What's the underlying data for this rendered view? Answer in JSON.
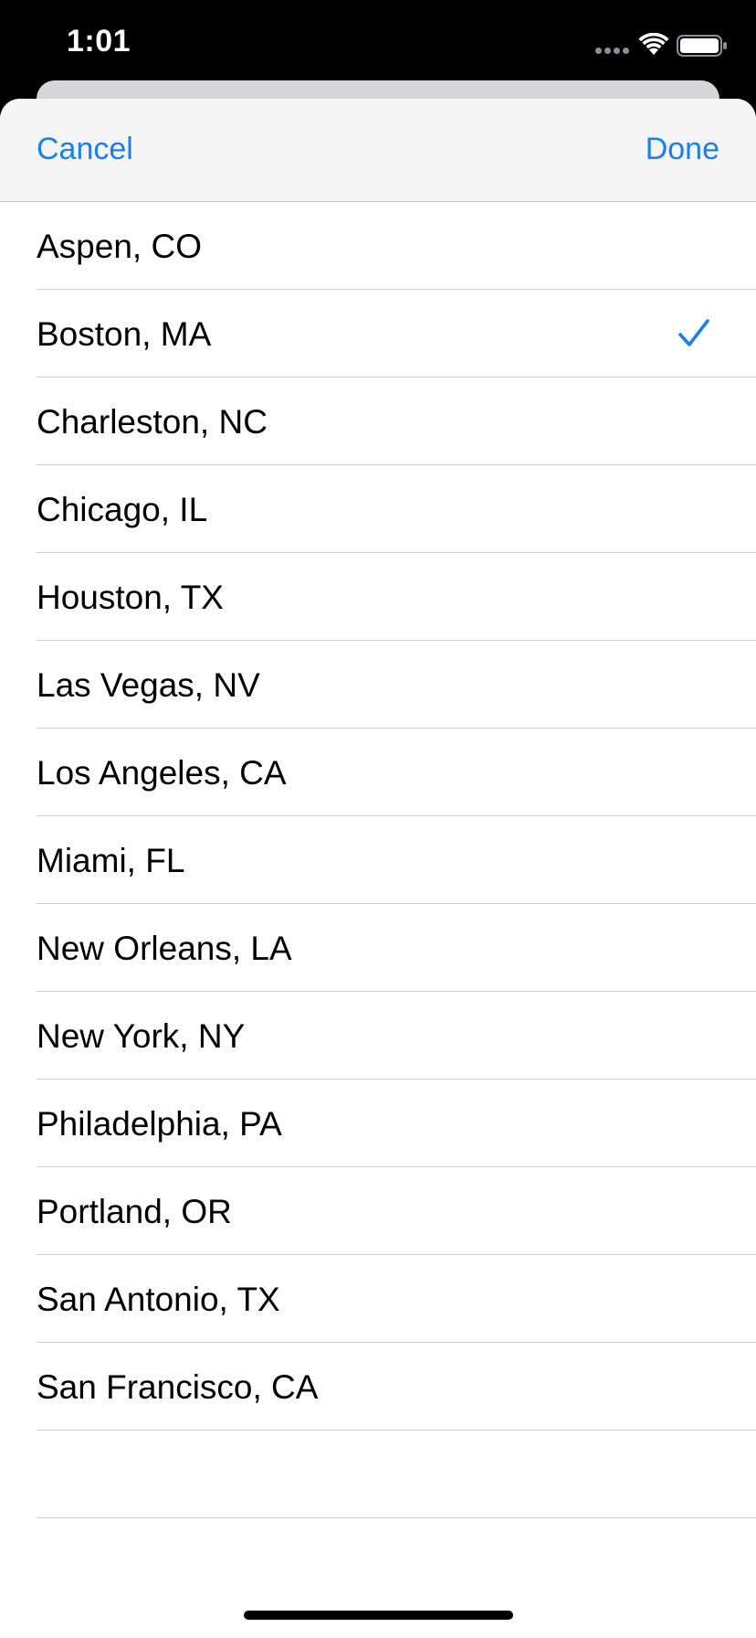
{
  "status_bar": {
    "time": "1:01",
    "icons": [
      "signal-dots-icon",
      "wifi-icon",
      "battery-icon"
    ]
  },
  "nav": {
    "cancel_label": "Cancel",
    "done_label": "Done"
  },
  "colors": {
    "accent": "#1a7ff0",
    "nav_background": "#f5f5f6",
    "separator": "#d1d1d6"
  },
  "cities": [
    {
      "label": "Aspen, CO",
      "selected": false
    },
    {
      "label": "Boston, MA",
      "selected": true
    },
    {
      "label": "Charleston, NC",
      "selected": false
    },
    {
      "label": "Chicago, IL",
      "selected": false
    },
    {
      "label": "Houston, TX",
      "selected": false
    },
    {
      "label": "Las Vegas, NV",
      "selected": false
    },
    {
      "label": "Los Angeles, CA",
      "selected": false
    },
    {
      "label": "Miami, FL",
      "selected": false
    },
    {
      "label": "New Orleans, LA",
      "selected": false
    },
    {
      "label": "New York, NY",
      "selected": false
    },
    {
      "label": "Philadelphia, PA",
      "selected": false
    },
    {
      "label": "Portland, OR",
      "selected": false
    },
    {
      "label": "San Antonio, TX",
      "selected": false
    },
    {
      "label": "San Francisco, CA",
      "selected": false
    }
  ]
}
